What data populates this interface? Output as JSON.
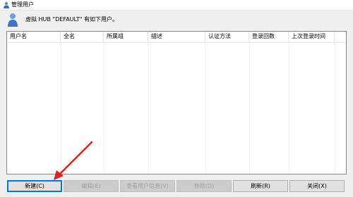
{
  "window": {
    "title": "管理用户",
    "title_icon": "user-icon"
  },
  "header": {
    "icon": "user-icon",
    "text": "虚拟 HUB \"DEFAULT\" 有如下用户。"
  },
  "table": {
    "columns": [
      "用户名",
      "全名",
      "所属组",
      "描述",
      "认证方法",
      "登录回数",
      "上次登录时间"
    ],
    "rows": []
  },
  "buttons": {
    "new": "新建(C)",
    "edit": "编辑(E)",
    "view_info": "查看用户信息(V)",
    "delete": "移除(D)",
    "refresh": "刷新(R)",
    "close": "关闭(X)"
  },
  "annotation": {
    "arrow_color": "#e02020"
  }
}
